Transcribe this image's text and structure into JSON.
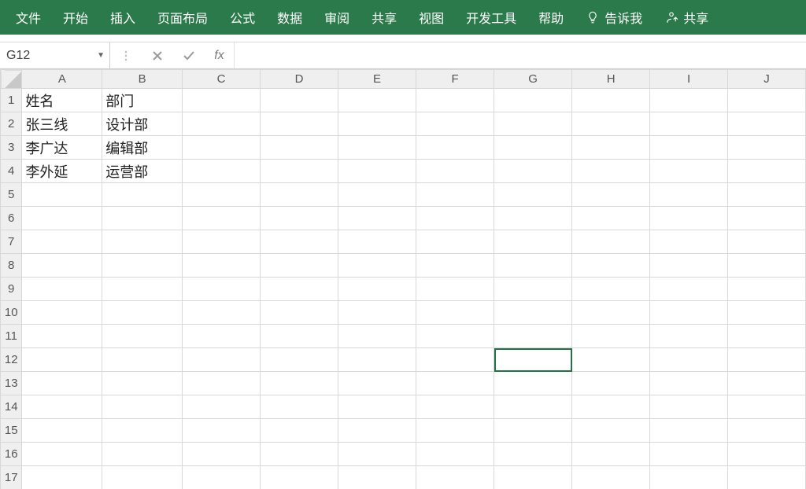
{
  "ribbon": {
    "tabs": [
      {
        "label": "文件"
      },
      {
        "label": "开始"
      },
      {
        "label": "插入"
      },
      {
        "label": "页面布局"
      },
      {
        "label": "公式"
      },
      {
        "label": "数据"
      },
      {
        "label": "审阅"
      },
      {
        "label": "共享"
      },
      {
        "label": "视图"
      },
      {
        "label": "开发工具"
      },
      {
        "label": "帮助"
      },
      {
        "label": "告诉我",
        "icon": "lightbulb-icon"
      },
      {
        "label": "共享",
        "icon": "share-icon"
      }
    ]
  },
  "formula_bar": {
    "name_box": "G12",
    "fx_label": "fx",
    "formula_value": ""
  },
  "sheet": {
    "columns": [
      "A",
      "B",
      "C",
      "D",
      "E",
      "F",
      "G",
      "H",
      "I",
      "J"
    ],
    "row_count": 17,
    "selected_cell": "G12",
    "cells": {
      "A1": "姓名",
      "B1": "部门",
      "A2": "张三线",
      "B2": "设计部",
      "A3": "李广达",
      "B3": "编辑部",
      "A4": "李外延",
      "B4": "运营部"
    }
  }
}
